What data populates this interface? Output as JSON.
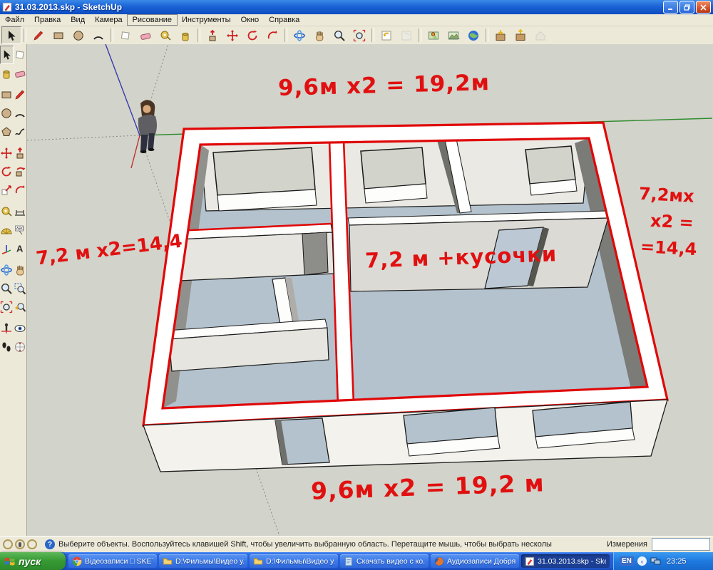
{
  "window": {
    "title": "31.03.2013.skp - SketchUp",
    "controls": [
      "minimize",
      "restore",
      "close"
    ]
  },
  "menu": {
    "items": [
      "Файл",
      "Правка",
      "Вид",
      "Камера",
      "Рисование",
      "Инструменты",
      "Окно",
      "Справка"
    ],
    "focused": "Рисование"
  },
  "toolbar_top": {
    "active_tool": "select",
    "tools": [
      "select",
      "line",
      "rectangle",
      "circle",
      "arc",
      "make-component",
      "eraser",
      "tape-measure",
      "paint-bucket",
      "push-pull",
      "move",
      "rotate",
      "offset",
      "orbit",
      "pan",
      "zoom",
      "zoom-extents",
      "previous-view",
      "next-view",
      "add-location",
      "toggle-terrain",
      "google-earth",
      "get-models",
      "share-model",
      "component-house"
    ]
  },
  "toolbar_left": {
    "active_tool": "select",
    "tools": [
      "select",
      "make-component",
      "paint-bucket",
      "eraser",
      "rectangle",
      "line",
      "circle",
      "arc",
      "polygon",
      "freehand",
      "move",
      "push-pull",
      "rotate",
      "follow-me",
      "scale",
      "offset",
      "tape-measure",
      "dimension",
      "protractor",
      "text",
      "axes",
      "3d-text",
      "orbit",
      "pan",
      "zoom",
      "zoom-window",
      "zoom-extents",
      "zoom-previous",
      "position-camera",
      "look-around",
      "walk",
      "section-plane"
    ]
  },
  "viewport": {
    "annotations": {
      "top": "9,6м х2 = 19,2м",
      "left": "7,2 м х2=14,4",
      "center": "7,2 м +кусочки",
      "bottom": "9,6м х2 = 19,2 м",
      "right_lines": [
        "7,2мх",
        "х2 =",
        "=14,4"
      ]
    },
    "colors": {
      "annotation_red": "#e11010",
      "outline_red": "#e00808",
      "floor": "#b3c2cd",
      "wall_top": "#ffffff",
      "background": "#d2d3ca"
    }
  },
  "status_bar": {
    "hint": "Выберите объекты. Воспользуйтесь клавишей Shift, чтобы увеличить выбранную область. Перетащите мышь, чтобы выбрать несколы",
    "measure_label": "Измерения",
    "measure_value": ""
  },
  "taskbar": {
    "start_label": "пуск",
    "buttons": [
      {
        "label": "Відеозаписи □ SKET...",
        "icon": "chrome-icon",
        "active": false
      },
      {
        "label": "D:\\Фильмы\\Видео у...",
        "icon": "folder-icon",
        "active": false
      },
      {
        "label": "D:\\Фильмы\\Видео у...",
        "icon": "folder-icon",
        "active": false
      },
      {
        "label": "Скачать видео с ко...",
        "icon": "document-icon",
        "active": false
      },
      {
        "label": "Аудиозаписи Добряк...",
        "icon": "firefox-icon",
        "active": false
      },
      {
        "label": "31.03.2013.skp - Ske...",
        "icon": "sketchup-icon",
        "active": true
      }
    ],
    "tray": {
      "language": "EN",
      "time": "23:25"
    }
  }
}
